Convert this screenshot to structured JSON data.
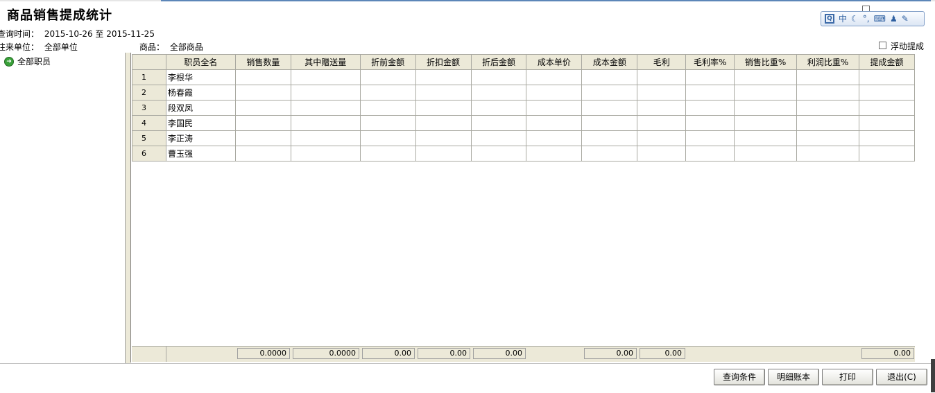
{
  "window": {
    "title": "商品销售提成统计"
  },
  "query": {
    "time_label": "查询时间：",
    "time_value": "2015-10-26 至 2015-11-25",
    "unit_label": "往来单位：",
    "unit_value": "全部单位",
    "product_label": "商品：",
    "product_value": "全部商品",
    "float_commission_label": "浮动提成",
    "float_commission_checked": false
  },
  "ime_toolbar": {
    "mode": "中",
    "icons": [
      "q-logo-icon",
      "moon-icon",
      "punctuation-icon",
      "keyboard-icon",
      "person-icon",
      "wrench-icon"
    ]
  },
  "tree": {
    "root_label": "全部职员"
  },
  "table": {
    "headers": [
      "职员全名",
      "销售数量",
      "其中赠送量",
      "折前金额",
      "折扣金额",
      "折后金额",
      "成本单价",
      "成本金额",
      "毛利",
      "毛利率%",
      "销售比重%",
      "利润比重%",
      "提成金额"
    ],
    "rows": [
      {
        "no": "1",
        "name": "李根华"
      },
      {
        "no": "2",
        "name": "杨春霞"
      },
      {
        "no": "3",
        "name": "段双凤"
      },
      {
        "no": "4",
        "name": "李国民"
      },
      {
        "no": "5",
        "name": "李正涛"
      },
      {
        "no": "6",
        "name": "曹玉强"
      }
    ],
    "totals": {
      "sales_qty": "0.0000",
      "gift_qty": "0.0000",
      "pre_discount": "0.00",
      "discount": "0.00",
      "post_discount": "0.00",
      "cost_amount": "0.00",
      "gross_profit": "0.00",
      "commission": "0.00"
    }
  },
  "buttons": {
    "query_conditions": "查询条件",
    "detail_ledger": "明细账本",
    "print": "打印",
    "exit": "退出(C)"
  }
}
